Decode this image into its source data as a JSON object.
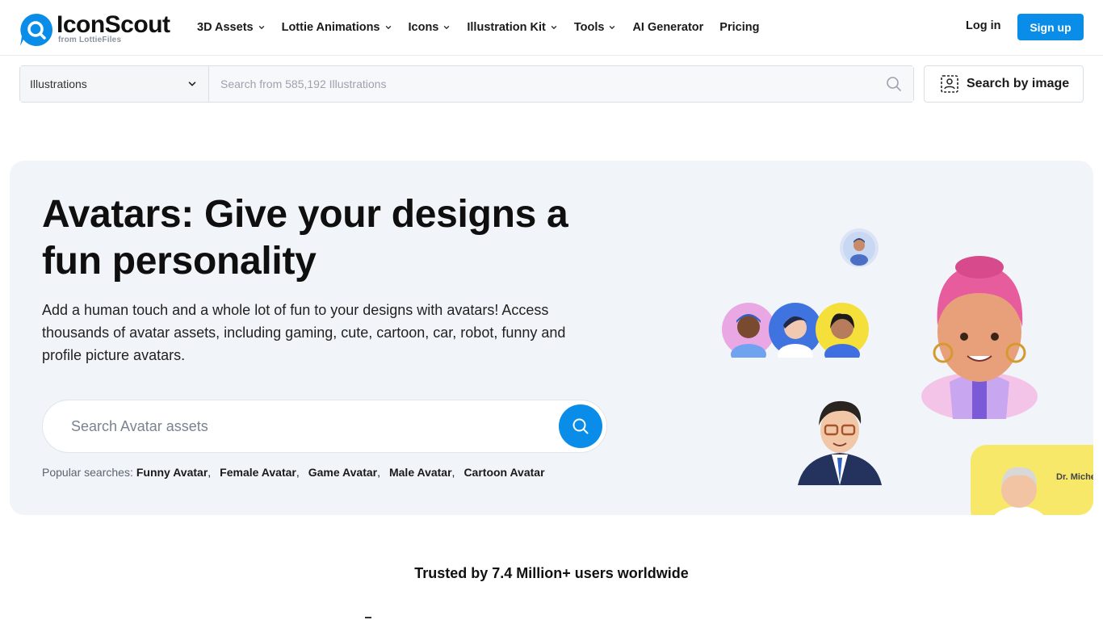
{
  "header": {
    "logo": {
      "name": "IconScout",
      "sub": "from LottieFiles"
    },
    "nav": [
      {
        "label": "3D Assets",
        "has_menu": true
      },
      {
        "label": "Lottie Animations",
        "has_menu": true
      },
      {
        "label": "Icons",
        "has_menu": true
      },
      {
        "label": "Illustration Kit",
        "has_menu": true
      },
      {
        "label": "Tools",
        "has_menu": true
      },
      {
        "label": "AI Generator",
        "has_menu": false
      },
      {
        "label": "Pricing",
        "has_menu": false
      }
    ],
    "login_label": "Log in",
    "signup_label": "Sign up"
  },
  "search": {
    "category_value": "Illustrations",
    "placeholder": "Search from 585,192 Illustrations",
    "by_image_label": "Search by image"
  },
  "hero": {
    "title": "Avatars: Give your designs a fun personality",
    "description": "Add a human touch and a whole lot of fun to your designs with avatars! Access thousands of avatar assets, including gaming, cute, cartoon, car, robot, funny and profile picture avatars.",
    "search_placeholder": "Search Avatar assets",
    "popular_label": "Popular searches:",
    "popular_tags": [
      "Funny Avatar",
      "Female Avatar",
      "Game Avatar",
      "Male Avatar",
      "Cartoon Avatar"
    ],
    "card_text": "Dr. Miche"
  },
  "trusted_text": "Trusted by 7.4 Million+ users worldwide",
  "colors": {
    "brand_blue": "#0a8de8",
    "hero_bg": "#f1f4f8"
  },
  "icons": [
    "search-icon",
    "chevron-down-icon",
    "image-search-icon"
  ]
}
